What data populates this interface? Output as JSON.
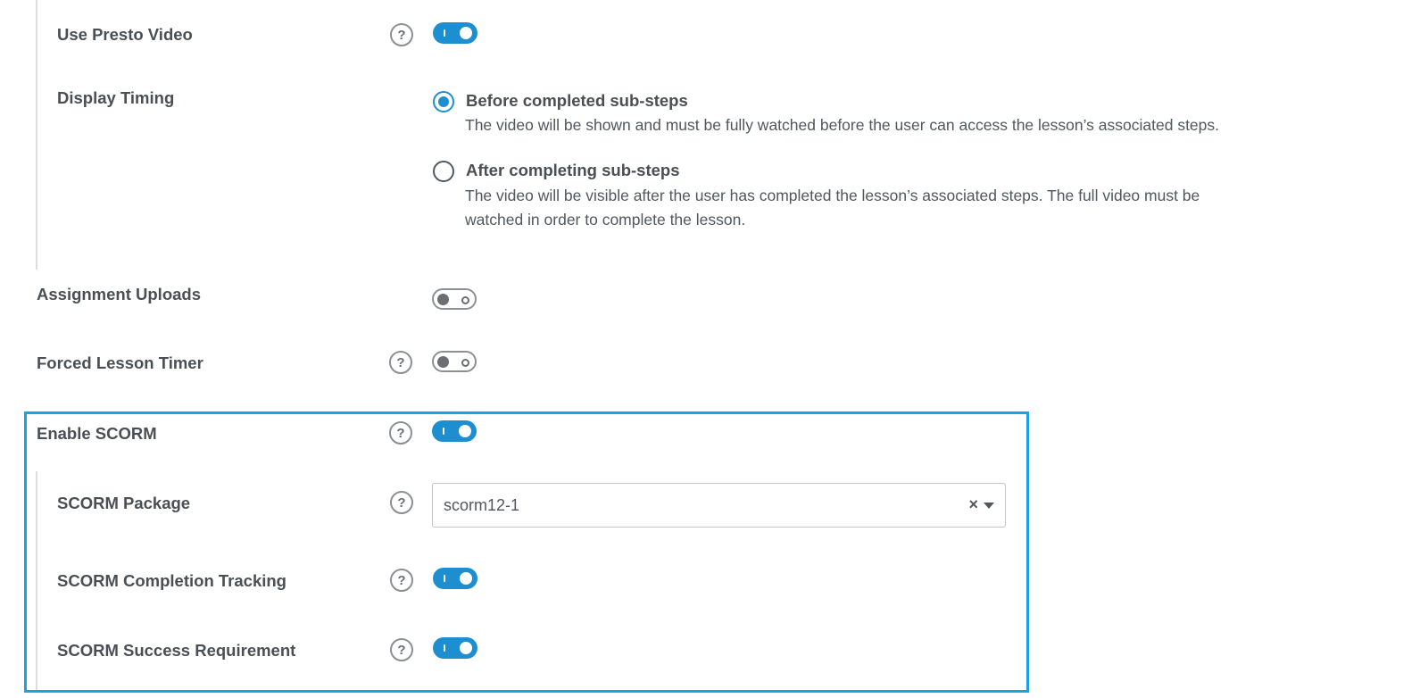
{
  "settings": {
    "presto_video": {
      "label": "Use Presto Video",
      "enabled": true
    },
    "display_timing": {
      "label": "Display Timing",
      "options": [
        {
          "title": "Before completed sub-steps",
          "description": "The video will be shown and must be fully watched before the user can access the lesson’s associated steps.",
          "selected": true
        },
        {
          "title": "After completing sub-steps",
          "description_line1": "The video will be visible after the user has completed the lesson’s associated steps. The full video must be",
          "description_line2": "watched in order to complete the lesson.",
          "selected": false
        }
      ]
    },
    "assignment_uploads": {
      "label": "Assignment Uploads",
      "enabled": false
    },
    "forced_lesson_timer": {
      "label": "Forced Lesson Timer",
      "enabled": false
    },
    "enable_scorm": {
      "label": "Enable SCORM",
      "enabled": true
    },
    "scorm_package": {
      "label": "SCORM Package",
      "value": "scorm12-1",
      "clear_symbol": "×"
    },
    "scorm_completion_tracking": {
      "label": "SCORM Completion Tracking",
      "enabled": true
    },
    "scorm_success_requirement": {
      "label": "SCORM Success Requirement",
      "enabled": true
    }
  },
  "help_glyph": "?",
  "colors": {
    "accent": "#1d8fd1",
    "highlight_border": "#1ea0e6",
    "toggle_off": "#8c8f94"
  }
}
